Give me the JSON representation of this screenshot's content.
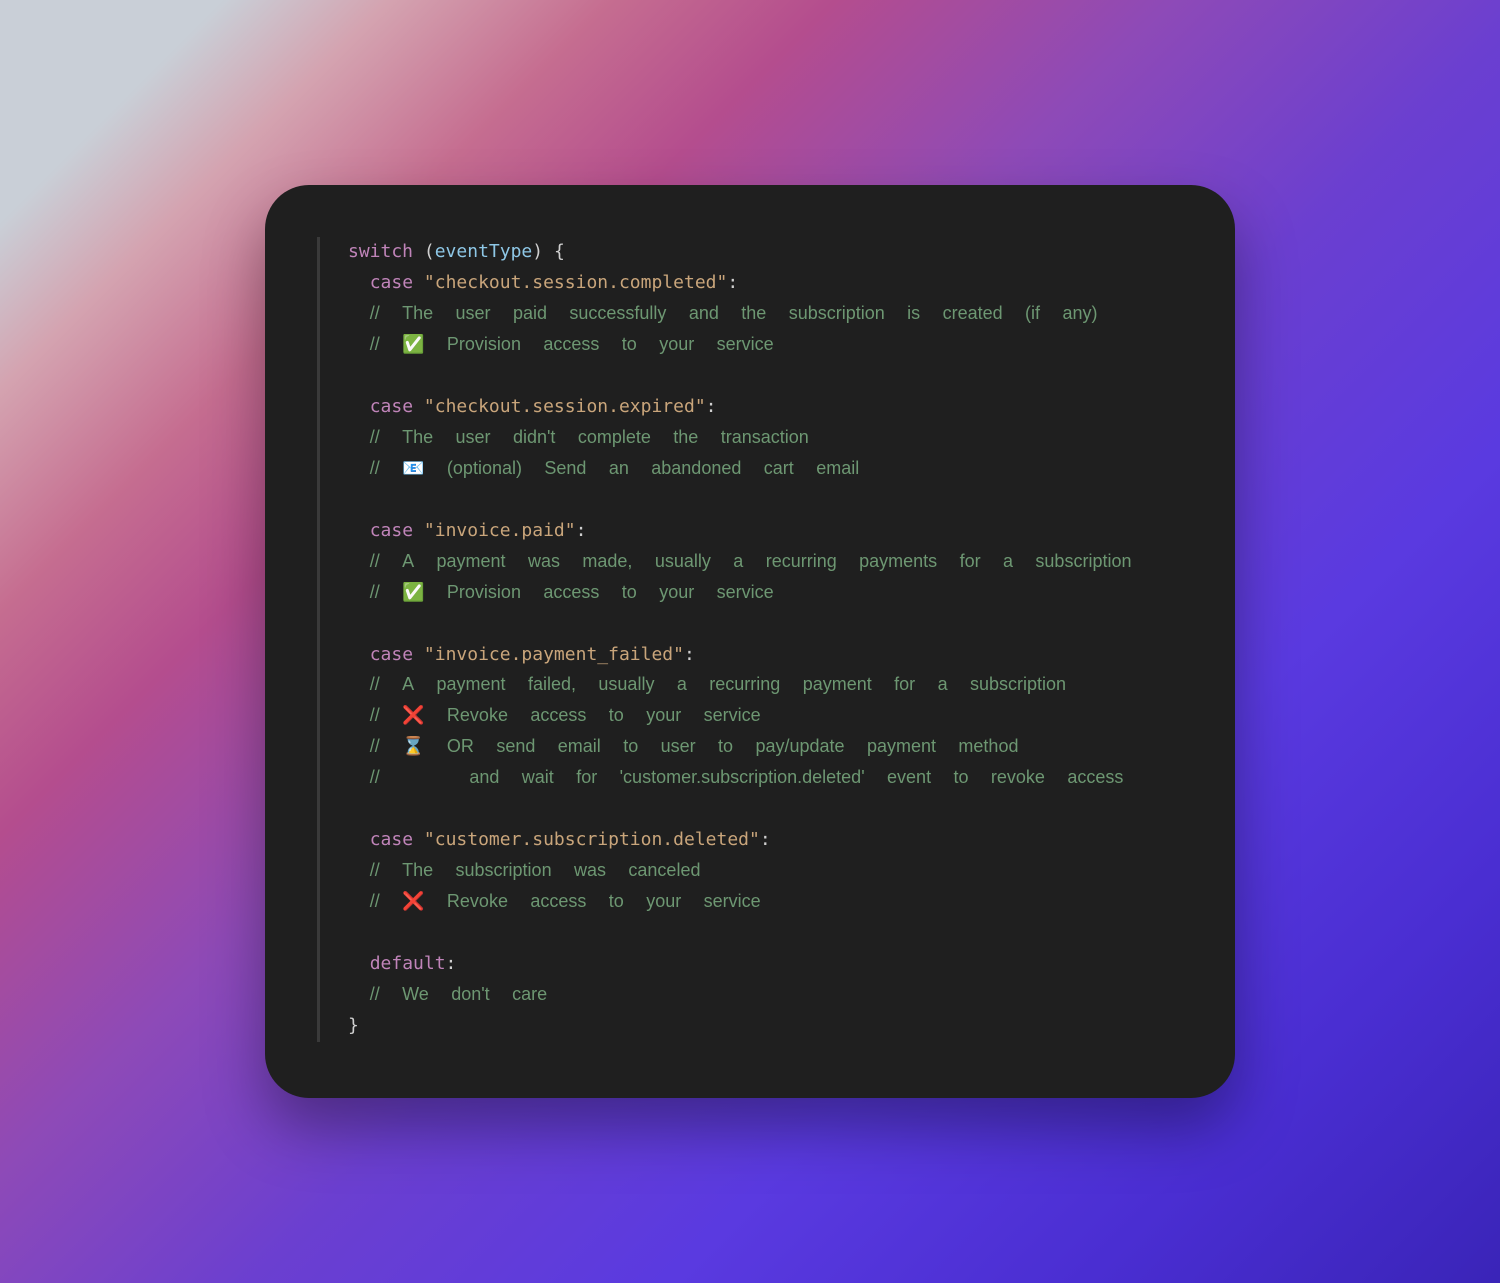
{
  "code": {
    "kw_switch": "switch",
    "paren_open": "(",
    "identifier": "eventType",
    "paren_close": ")",
    "brace_open": "{",
    "kw_case": "case",
    "kw_default": "default",
    "colon": ":",
    "brace_close": "}",
    "blocks": [
      {
        "str": "\"checkout.session.completed\"",
        "comments": [
          "// The user paid successfully and the subscription is created (if any)",
          "// ✅ Provision access to your service"
        ]
      },
      {
        "str": "\"checkout.session.expired\"",
        "comments": [
          "// The user didn't complete the transaction",
          "// 📧 (optional) Send an abandoned cart email"
        ]
      },
      {
        "str": "\"invoice.paid\"",
        "comments": [
          "// A payment was made, usually a recurring payments for a subscription",
          "// ✅ Provision access to your service"
        ]
      },
      {
        "str": "\"invoice.payment_failed\"",
        "comments": [
          "// A payment failed, usually a recurring payment for a subscription",
          "// ❌ Revoke access to your service",
          "// ⌛ OR send email to user to pay/update payment method",
          "//    and wait for 'customer.subscription.deleted' event to revoke access"
        ]
      },
      {
        "str": "\"customer.subscription.deleted\"",
        "comments": [
          "// The subscription was canceled",
          "// ❌ Revoke access to your service"
        ]
      }
    ],
    "default_comment": "// We don't care"
  }
}
